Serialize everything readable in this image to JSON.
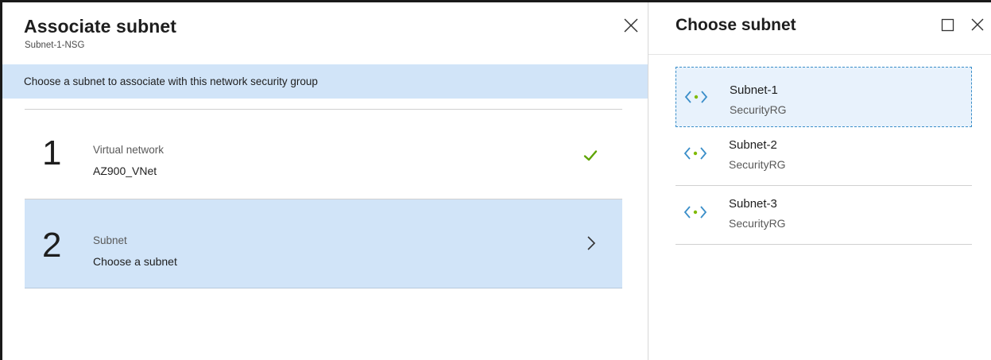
{
  "left_blade": {
    "title": "Associate subnet",
    "subtitle": "Subnet-1-NSG",
    "info_text": "Choose a subnet to associate with this network security group",
    "steps": [
      {
        "number": "1",
        "label": "Virtual network",
        "value": "AZ900_VNet",
        "status_icon": "check-icon"
      },
      {
        "number": "2",
        "label": "Subnet",
        "value": "Choose a subnet",
        "status_icon": "chevron-right-icon"
      }
    ]
  },
  "right_blade": {
    "title": "Choose subnet",
    "subnets": [
      {
        "name": "Subnet-1",
        "resource_group": "SecurityRG",
        "selected": true
      },
      {
        "name": "Subnet-2",
        "resource_group": "SecurityRG",
        "selected": false
      },
      {
        "name": "Subnet-3",
        "resource_group": "SecurityRG",
        "selected": false
      }
    ]
  },
  "colors": {
    "highlight_blue": "#d1e4f8",
    "selected_item_bg": "#e8f2fc",
    "check_green": "#5ea400",
    "vnet_icon_blue": "#3a8ec9",
    "vnet_dot_green": "#7fba00"
  },
  "icons": {
    "close": "close-icon",
    "maximize": "maximize-icon",
    "check": "check-icon",
    "chevron": "chevron-right-icon",
    "subnet": "virtual-network-icon"
  }
}
